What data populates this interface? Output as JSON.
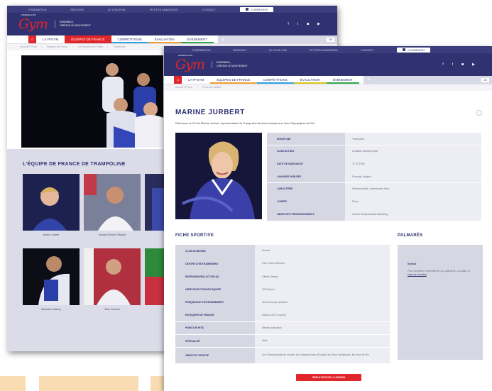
{
  "topbar": {
    "links": [
      "FEDERATION",
      "REGIONS",
      "LE GYM HUB",
      "PETITES ANNONCES",
      "CONTACT"
    ],
    "login_label": "CONNEXION"
  },
  "header": {
    "logo_main": "Gym",
    "logo_sub": "FRANCE GYM",
    "tagline_line1": "ENSEMBLE,",
    "tagline_line2": "CRÉONS LE MOUVEMENT"
  },
  "social_icons": [
    "facebook-icon",
    "twitter-icon",
    "instagram-icon",
    "youtube-icon"
  ],
  "back_nav": {
    "items": [
      "LA FFGYM",
      "ÉQUIPES DE FRANCE",
      "COMPÉTITIONS",
      "ÉVALUATION",
      "ÉVÉNEMENT"
    ],
    "search_ok": "OK"
  },
  "back_breadcrumb": [
    "Accueil FFGym",
    "Équipes de France",
    "Les équipes de France",
    "Trampoline"
  ],
  "team": {
    "title": "L'ÉQUIPE DE FRANCE DE TRAMPOLINE",
    "members": [
      "Marine Jurbert",
      "Morgan Demiro O'Bryant",
      "",
      "Sébastien Martiny",
      "Allan Morante",
      ""
    ]
  },
  "front_nav": {
    "items": [
      "LA FFGYM",
      "ÉQUIPES DE FRANCE",
      "COMPÉTITIONS",
      "ÉVALUATION",
      "ÉVÉNEMENT"
    ],
    "search_ok": "OK"
  },
  "front_breadcrumb": [
    "Accueil FFGym",
    "Fiche de l'athlète"
  ],
  "athlete": {
    "name": "MARINE JURBERT",
    "intro": "Retrouvez la CV de Marine Jurbert, représentante du Trampoline féminin français aux Jeux Olympiques de Rio.",
    "info": [
      {
        "k": "DISCIPLINE",
        "v": "Trampoline"
      },
      {
        "k": "CLUB ACTUEL",
        "v": "Levallois Sporting Club"
      },
      {
        "k": "DATE DE NAISSANCE",
        "v": "17.07.1994"
      },
      {
        "k": "LANGUES PARLÉES",
        "v": "Français, Anglais"
      },
      {
        "k": "CARACTÈRE",
        "v": "Perfectionniste, déterminée, têtue"
      },
      {
        "k": "LOISIRS",
        "v": "Piano"
      },
      {
        "k": "OBJECTIFS PROFESSIONNELS",
        "v": "Licence Responsable Marketing"
      }
    ]
  },
  "fiche": {
    "title": "FICHE SPORTIVE",
    "rows": [
      {
        "k": "CLUB D'ORIGINE",
        "v": "Dormis"
      },
      {
        "k": "CENTRE D'ENTRAÎNEMENT",
        "v": "Pôle France Rennes"
      },
      {
        "k": "ENTRAÎNEUR(S) ACTUEL(S)",
        "v": "Gilbert Gharini"
      },
      {
        "k": "1ÈRE SÉLECTION EN ÉQUIPE",
        "v": "2010 Seoul"
      },
      {
        "k": "FRÉQUENCE D'ENTRAÎNEMENT",
        "v": "20 heures par semaine"
      },
      {
        "k": "EN ÉQUIPE DE FRANCE",
        "v": "Depuis 2010 en junior"
      },
      {
        "k": "POINTS FORTS",
        "v": "Mental, exécution"
      },
      {
        "k": "SPÉCIALITÉ",
        "v": "Vrille"
      },
      {
        "k": "OBJECTIF SPORTIF",
        "v": "Les Championnats du monde, les Championnats d'Europe, les Jeux Olympiques, les Jeux de Rio"
      }
    ]
  },
  "palmares": {
    "title": "PALMARÈS",
    "head": "Sénior",
    "text": "Pour connaître l'ensemble de son palmarès, consultez la",
    "link": "base de données"
  },
  "cta_label": "RÉSULTATS DE LA SAISON"
}
